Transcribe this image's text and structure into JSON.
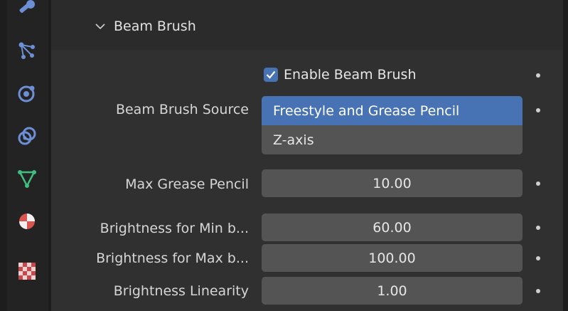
{
  "colors": {
    "accent": "#4772b3",
    "panel_bg": "#303030",
    "field_bg": "#545454",
    "sidebar_bg": "#1d1d1d"
  },
  "sidebar": {
    "icons": [
      "tool-icon",
      "particles-icon",
      "physics-icon",
      "constraints-icon",
      "object-data-icon",
      "material-icon",
      "texture-icon"
    ]
  },
  "panel": {
    "title": "Beam Brush",
    "enable": {
      "label": "Enable Beam Brush",
      "checked": true
    },
    "source": {
      "label": "Beam Brush Source",
      "options": [
        "Freestyle and Grease Pencil",
        "Z-axis"
      ],
      "selected": "Freestyle and Grease Pencil"
    },
    "max_grease_pencil": {
      "label": "Max Grease Pencil",
      "value": "10.00"
    },
    "brightness_min": {
      "label": "Brightness for Min b...",
      "value": "60.00"
    },
    "brightness_max": {
      "label": "Brightness for Max b...",
      "value": "100.00"
    },
    "brightness_linearity": {
      "label": "Brightness Linearity",
      "value": "1.00"
    }
  }
}
